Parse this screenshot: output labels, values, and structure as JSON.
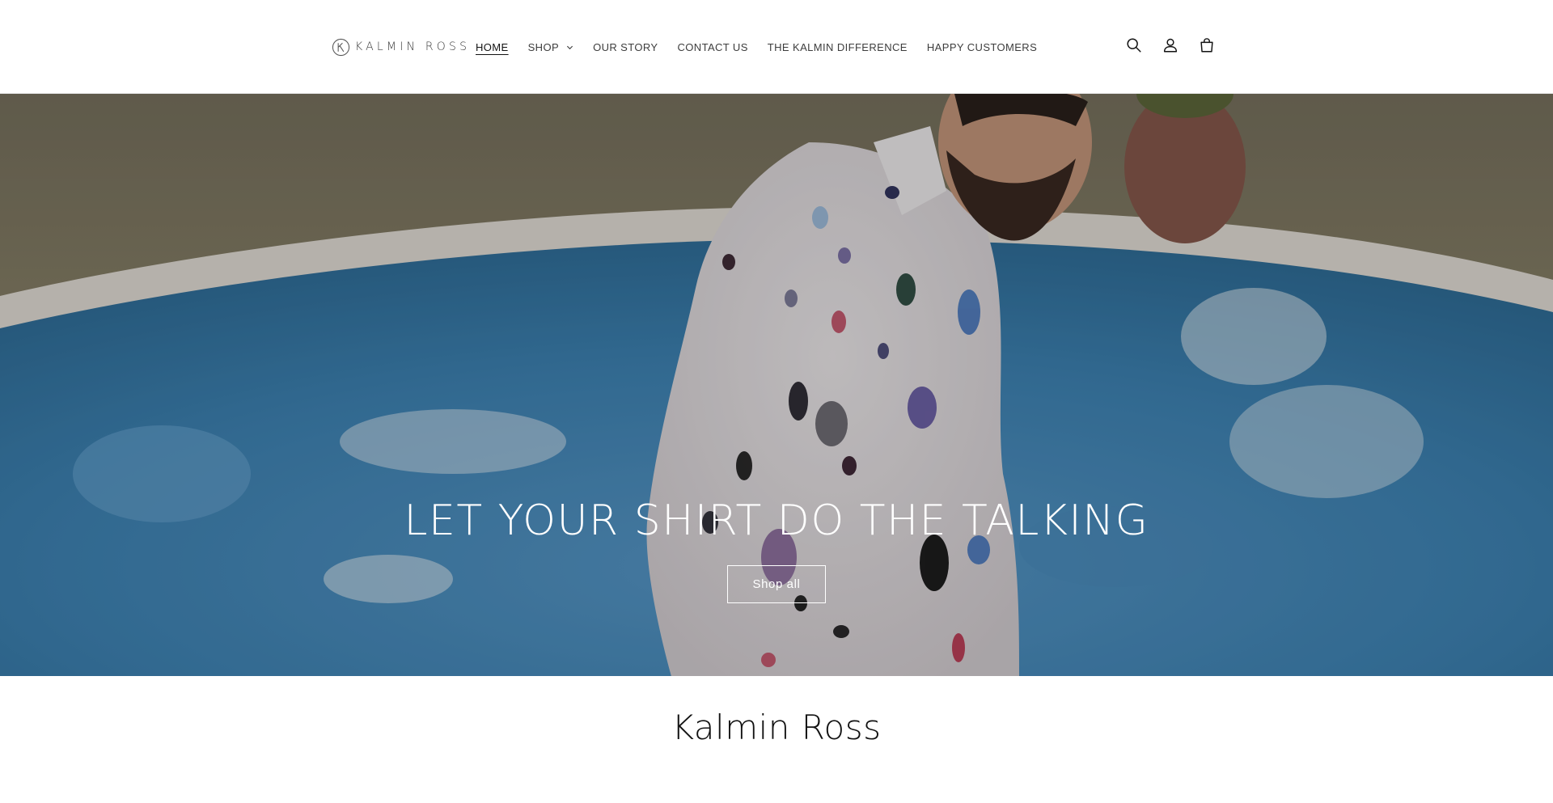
{
  "brand": {
    "logo_text": "KALMIN ROSS"
  },
  "nav": {
    "items": [
      {
        "label": "HOME",
        "active": true
      },
      {
        "label": "SHOP",
        "has_dropdown": true
      },
      {
        "label": "OUR STORY"
      },
      {
        "label": "CONTACT US"
      },
      {
        "label": "THE KALMIN DIFFERENCE"
      },
      {
        "label": "HAPPY CUSTOMERS"
      }
    ]
  },
  "header_icons": [
    "search-icon",
    "account-icon",
    "cart-icon"
  ],
  "hero": {
    "title": "LET YOUR SHIRT DO THE TALKING",
    "button_label": "Shop all"
  },
  "section": {
    "heading": "Kalmin Ross"
  },
  "colors": {
    "text": "#121212",
    "overlay": "rgba(0,0,0,0.25)",
    "pool": "#3f86b8"
  }
}
